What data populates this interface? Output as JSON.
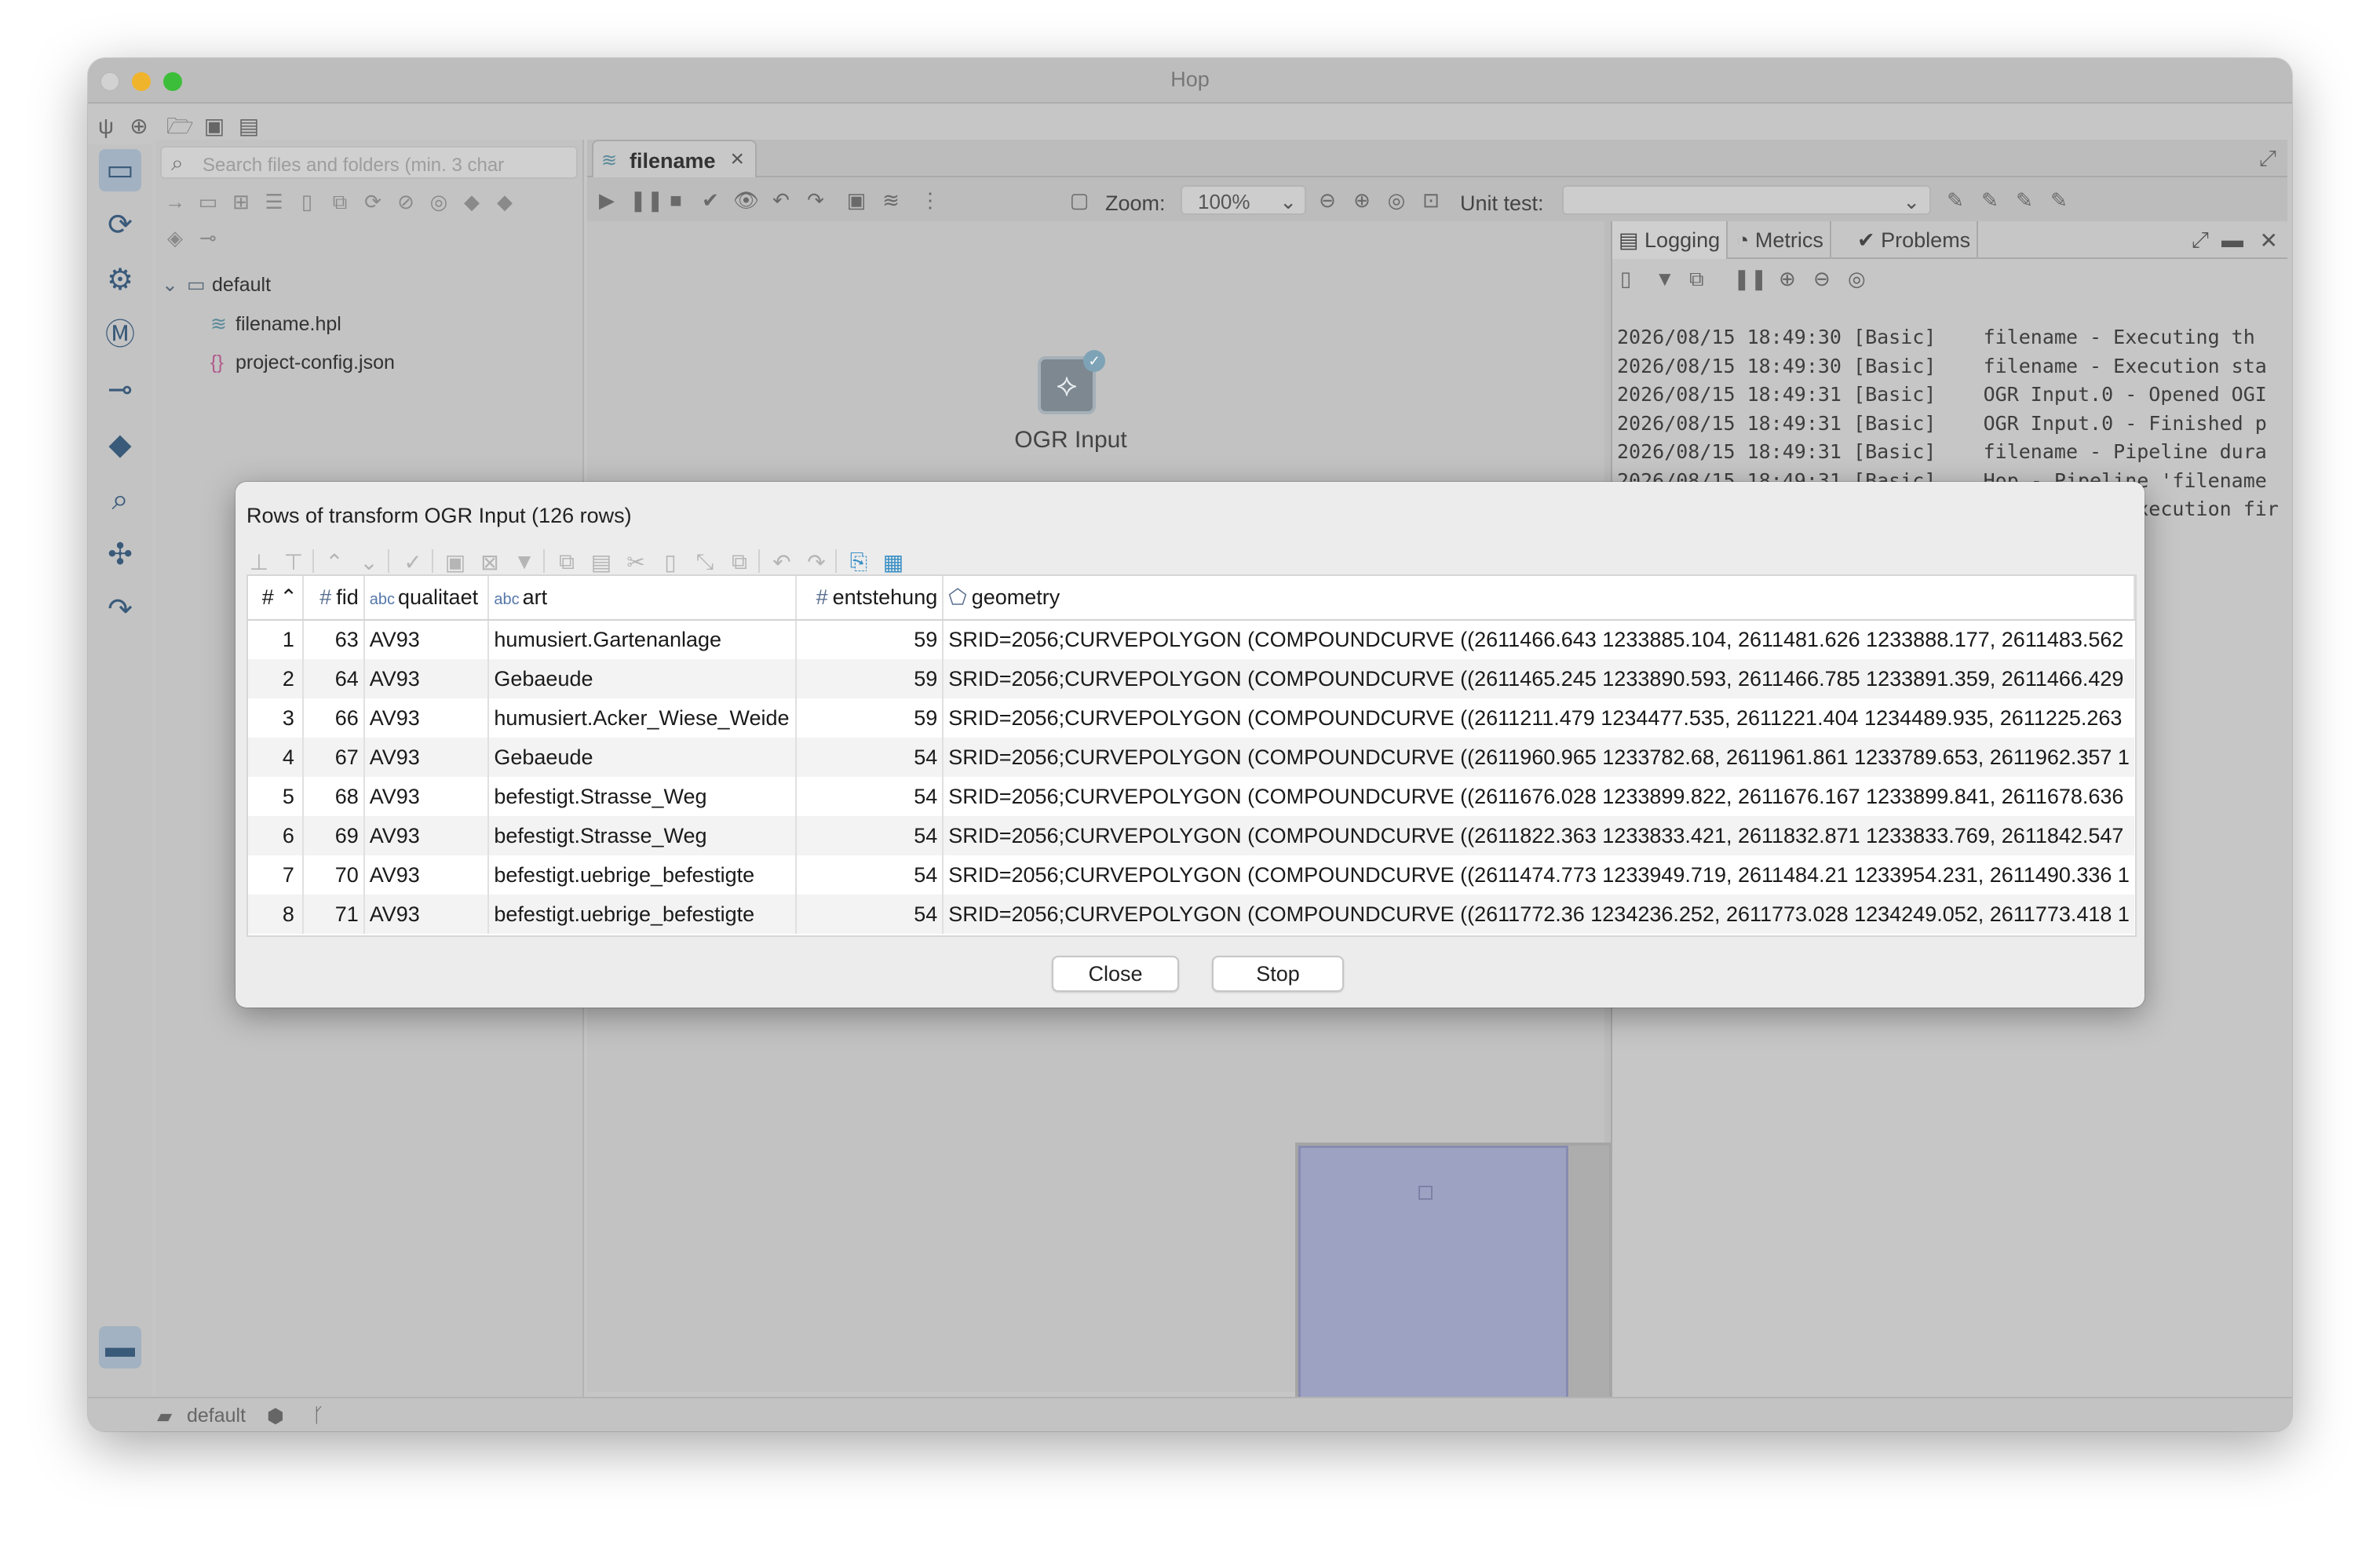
{
  "window": {
    "title": "Hop"
  },
  "explorer": {
    "search_placeholder": "Search files and folders (min. 3 char",
    "tree": [
      {
        "label": "default",
        "type": "folder"
      },
      {
        "label": "filename.hpl",
        "type": "pipeline"
      },
      {
        "label": "project-config.json",
        "type": "json"
      }
    ]
  },
  "editor": {
    "tab_label": "filename",
    "zoom_label": "Zoom:",
    "zoom_value": "100%",
    "unit_test_label": "Unit test:",
    "unit_test_value": "",
    "transform_label": "OGR Input"
  },
  "log_panel": {
    "tabs": [
      "Logging",
      "Metrics",
      "Problems"
    ],
    "lines": [
      "2026/08/15 18:49:30 [Basic]    filename - Executing th",
      "2026/08/15 18:49:30 [Basic]    filename - Execution sta",
      "2026/08/15 18:49:31 [Basic]    OGR Input.0 - Opened OGI",
      "2026/08/15 18:49:31 [Basic]    OGR Input.0 - Finished p",
      "2026/08/15 18:49:31 [Basic]    filename - Pipeline dura",
      "2026/08/15 18:49:31 [Basic]    Hop - Pipeline 'filename",
      "                                            xecution fir"
    ]
  },
  "statusbar": {
    "project": "default"
  },
  "dialog": {
    "title": "Rows of transform OGR Input (126 rows)",
    "columns": [
      {
        "label": "#",
        "type": "rownum",
        "sort": "asc"
      },
      {
        "label": "fid",
        "type": "number"
      },
      {
        "label": "qualitaet",
        "type": "string"
      },
      {
        "label": "art",
        "type": "string"
      },
      {
        "label": "entstehung",
        "type": "number"
      },
      {
        "label": "geometry",
        "type": "geometry"
      }
    ],
    "rows": [
      [
        "1",
        "63",
        "AV93",
        "humusiert.Gartenanlage",
        "59",
        "SRID=2056;CURVEPOLYGON (COMPOUNDCURVE ((2611466.643 1233885.104, 2611481.626 1233888.177, 2611483.562"
      ],
      [
        "2",
        "64",
        "AV93",
        "Gebaeude",
        "59",
        "SRID=2056;CURVEPOLYGON (COMPOUNDCURVE ((2611465.245 1233890.593, 2611466.785 1233891.359, 2611466.429"
      ],
      [
        "3",
        "66",
        "AV93",
        "humusiert.Acker_Wiese_Weide",
        "59",
        "SRID=2056;CURVEPOLYGON (COMPOUNDCURVE ((2611211.479 1234477.535, 2611221.404 1234489.935, 2611225.263"
      ],
      [
        "4",
        "67",
        "AV93",
        "Gebaeude",
        "54",
        "SRID=2056;CURVEPOLYGON (COMPOUNDCURVE ((2611960.965 1233782.68, 2611961.861 1233789.653, 2611962.357 1"
      ],
      [
        "5",
        "68",
        "AV93",
        "befestigt.Strasse_Weg",
        "54",
        "SRID=2056;CURVEPOLYGON (COMPOUNDCURVE ((2611676.028 1233899.822, 2611676.167 1233899.841, 2611678.636"
      ],
      [
        "6",
        "69",
        "AV93",
        "befestigt.Strasse_Weg",
        "54",
        "SRID=2056;CURVEPOLYGON (COMPOUNDCURVE ((2611822.363 1233833.421, 2611832.871 1233833.769, 2611842.547"
      ],
      [
        "7",
        "70",
        "AV93",
        "befestigt.uebrige_befestigte",
        "54",
        "SRID=2056;CURVEPOLYGON (COMPOUNDCURVE ((2611474.773 1233949.719, 2611484.21 1233954.231, 2611490.336 1"
      ],
      [
        "8",
        "71",
        "AV93",
        "befestigt.uebrige_befestigte",
        "54",
        "SRID=2056;CURVEPOLYGON (COMPOUNDCURVE ((2611772.36 1234236.252, 2611773.028 1234249.052, 2611773.418 1"
      ]
    ],
    "buttons": {
      "close": "Close",
      "stop": "Stop"
    }
  }
}
